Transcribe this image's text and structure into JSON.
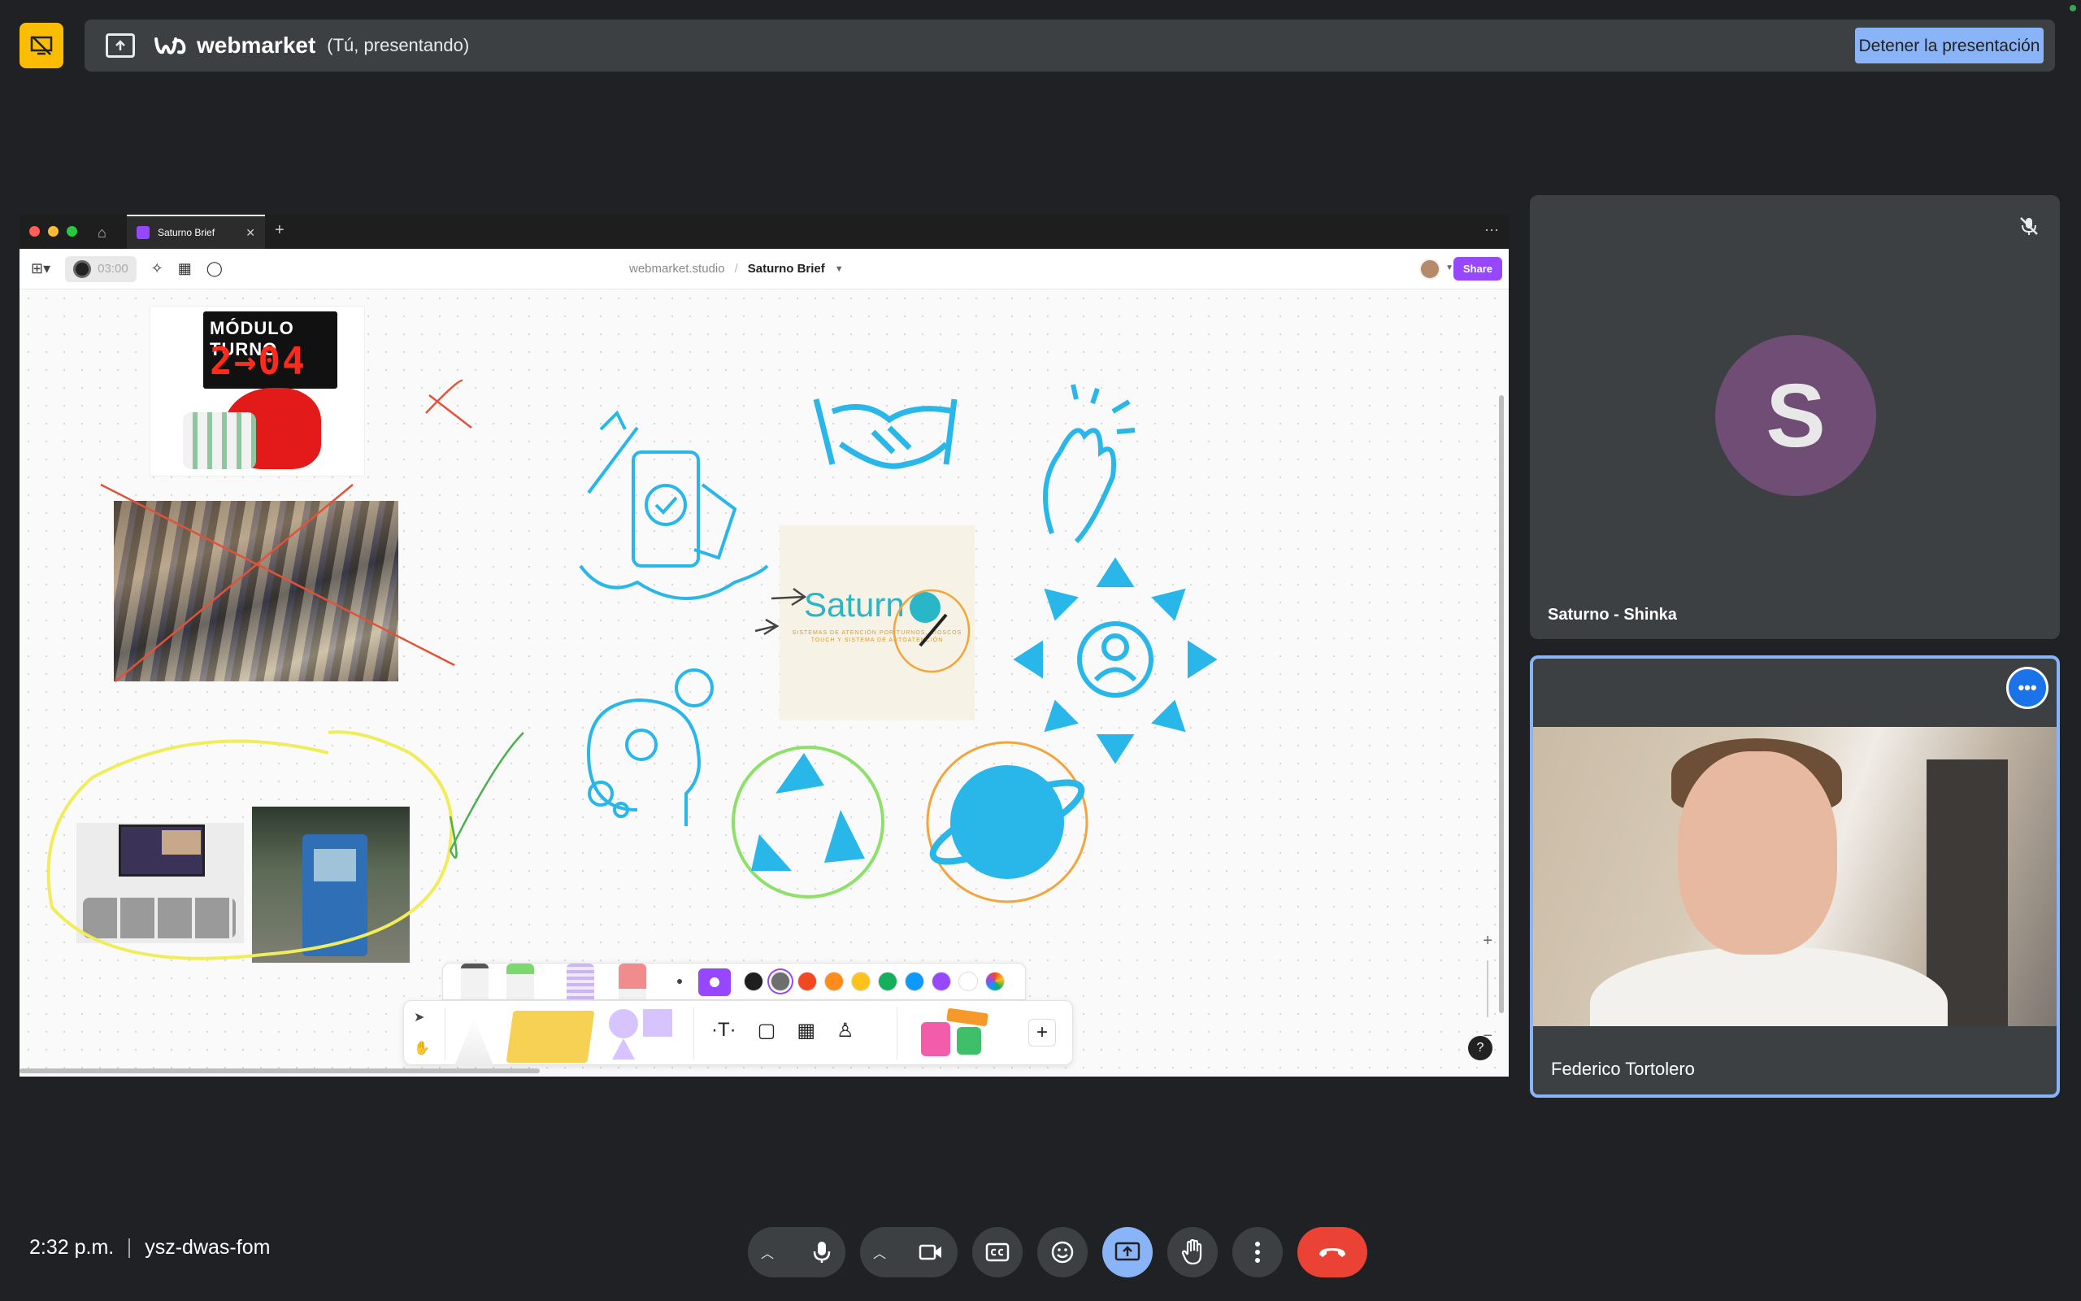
{
  "present_bar": {
    "brand": "webmarket",
    "status_text": "(Tú, presentando)",
    "stop_button": "Detener la presentación"
  },
  "shared_window": {
    "tab_title": "Saturno Brief",
    "timer": "03:00",
    "team_name": "webmarket.studio",
    "file_name": "Saturno Brief",
    "share_label": "Share",
    "canvas": {
      "turno_title": "MÓDULO TURNO",
      "turno_number": "2→04",
      "logo_word": "Saturn",
      "logo_subtitle": "SISTEMAS DE ATENCIÓN POR TURNOS, KIOSCOS TOUCH Y SISTEMA DE AUTOATENCIÓN"
    },
    "palette_colors": [
      "#1e1e1e",
      "#6e6e6e",
      "#f24822",
      "#ff8c1a",
      "#ffc21a",
      "#14ae5c",
      "#0d99ff",
      "#9747ff",
      "#ffffff"
    ],
    "help": "?"
  },
  "participants": [
    {
      "name": "Saturno - Shinka",
      "initial": "S",
      "avatar_color": "#6f4d75",
      "muted": true
    },
    {
      "name": "Federico Tortolero",
      "speaking": true
    }
  ],
  "meeting": {
    "time": "2:32 p.m.",
    "code": "ysz-dwas-fom"
  },
  "colors": {
    "background": "#202124",
    "present_accent": "#fbbc04",
    "active_blue": "#8ab4f8",
    "end_call": "#ea4335"
  }
}
